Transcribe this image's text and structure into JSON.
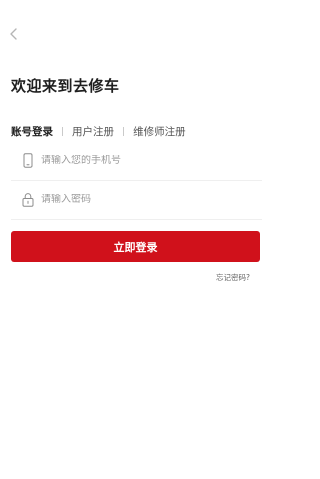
{
  "header": {
    "back_icon": "chevron-left-icon"
  },
  "welcome_title": "欢迎来到去修车",
  "tabs": [
    {
      "label": "账号登录",
      "active": true
    },
    {
      "label": "用户注册",
      "active": false
    },
    {
      "label": "维修师注册",
      "active": false
    }
  ],
  "tab_separator": "|",
  "phone_field": {
    "icon": "phone-icon",
    "placeholder": "请输入您的手机号",
    "value": ""
  },
  "password_field": {
    "icon": "lock-icon",
    "placeholder": "请输入密码",
    "value": ""
  },
  "login_button": {
    "label": "立即登录",
    "color": "#d0111b"
  },
  "forgot_password": "忘记密码?"
}
